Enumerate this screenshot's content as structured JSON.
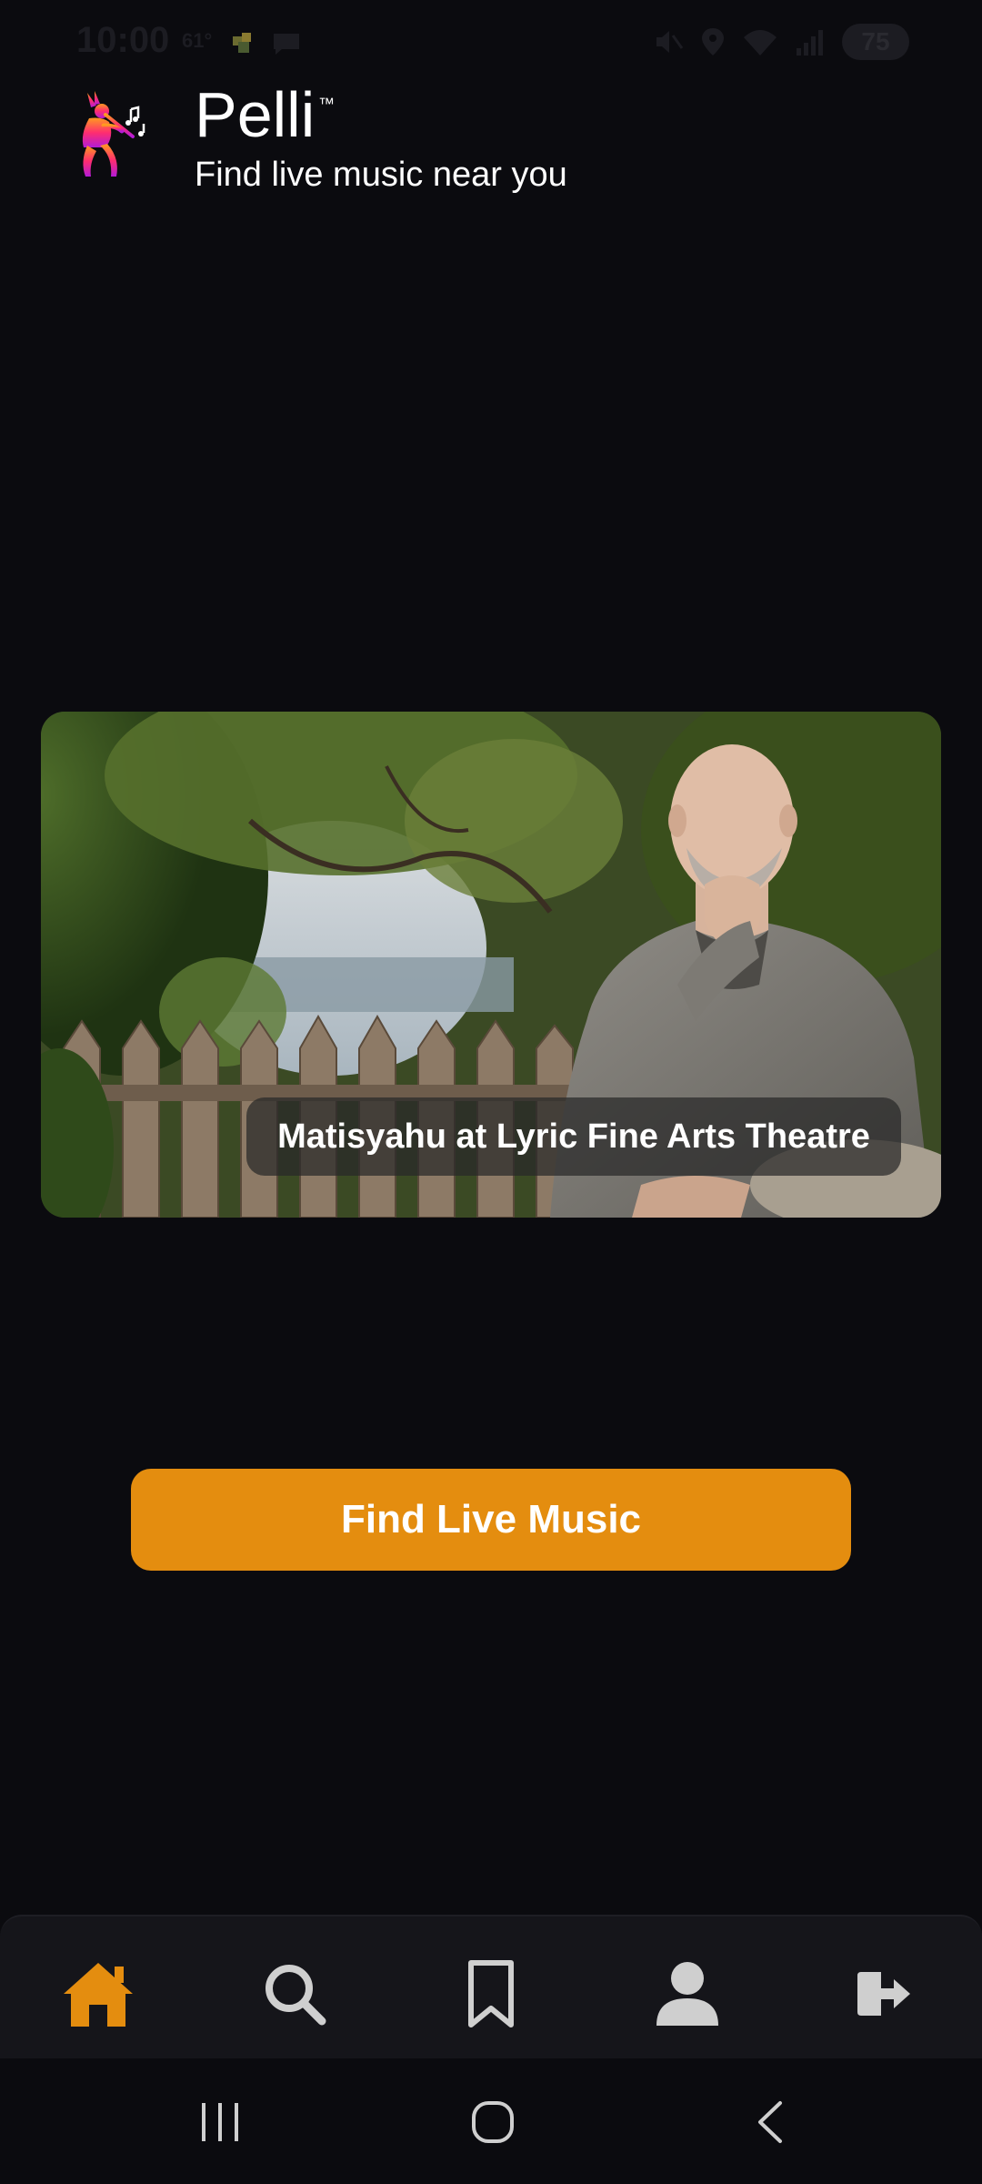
{
  "status_bar": {
    "time": "10:00",
    "temperature": "61°",
    "battery": "75"
  },
  "header": {
    "app_name": "Pelli",
    "trademark": "™",
    "tagline": "Find live music near you"
  },
  "featured": {
    "caption": "Matisyahu at Lyric Fine Arts Theatre"
  },
  "cta": {
    "label": "Find Live Music"
  },
  "bottom_nav": {
    "items": [
      {
        "icon": "home-icon",
        "active": true
      },
      {
        "icon": "search-icon",
        "active": false
      },
      {
        "icon": "bookmark-icon",
        "active": false
      },
      {
        "icon": "profile-icon",
        "active": false
      },
      {
        "icon": "logout-icon",
        "active": false
      }
    ]
  },
  "colors": {
    "background": "#0b0b0f",
    "accent": "#e48d0f",
    "nav_background": "#15151a",
    "nav_inactive": "#cfcfcf"
  }
}
